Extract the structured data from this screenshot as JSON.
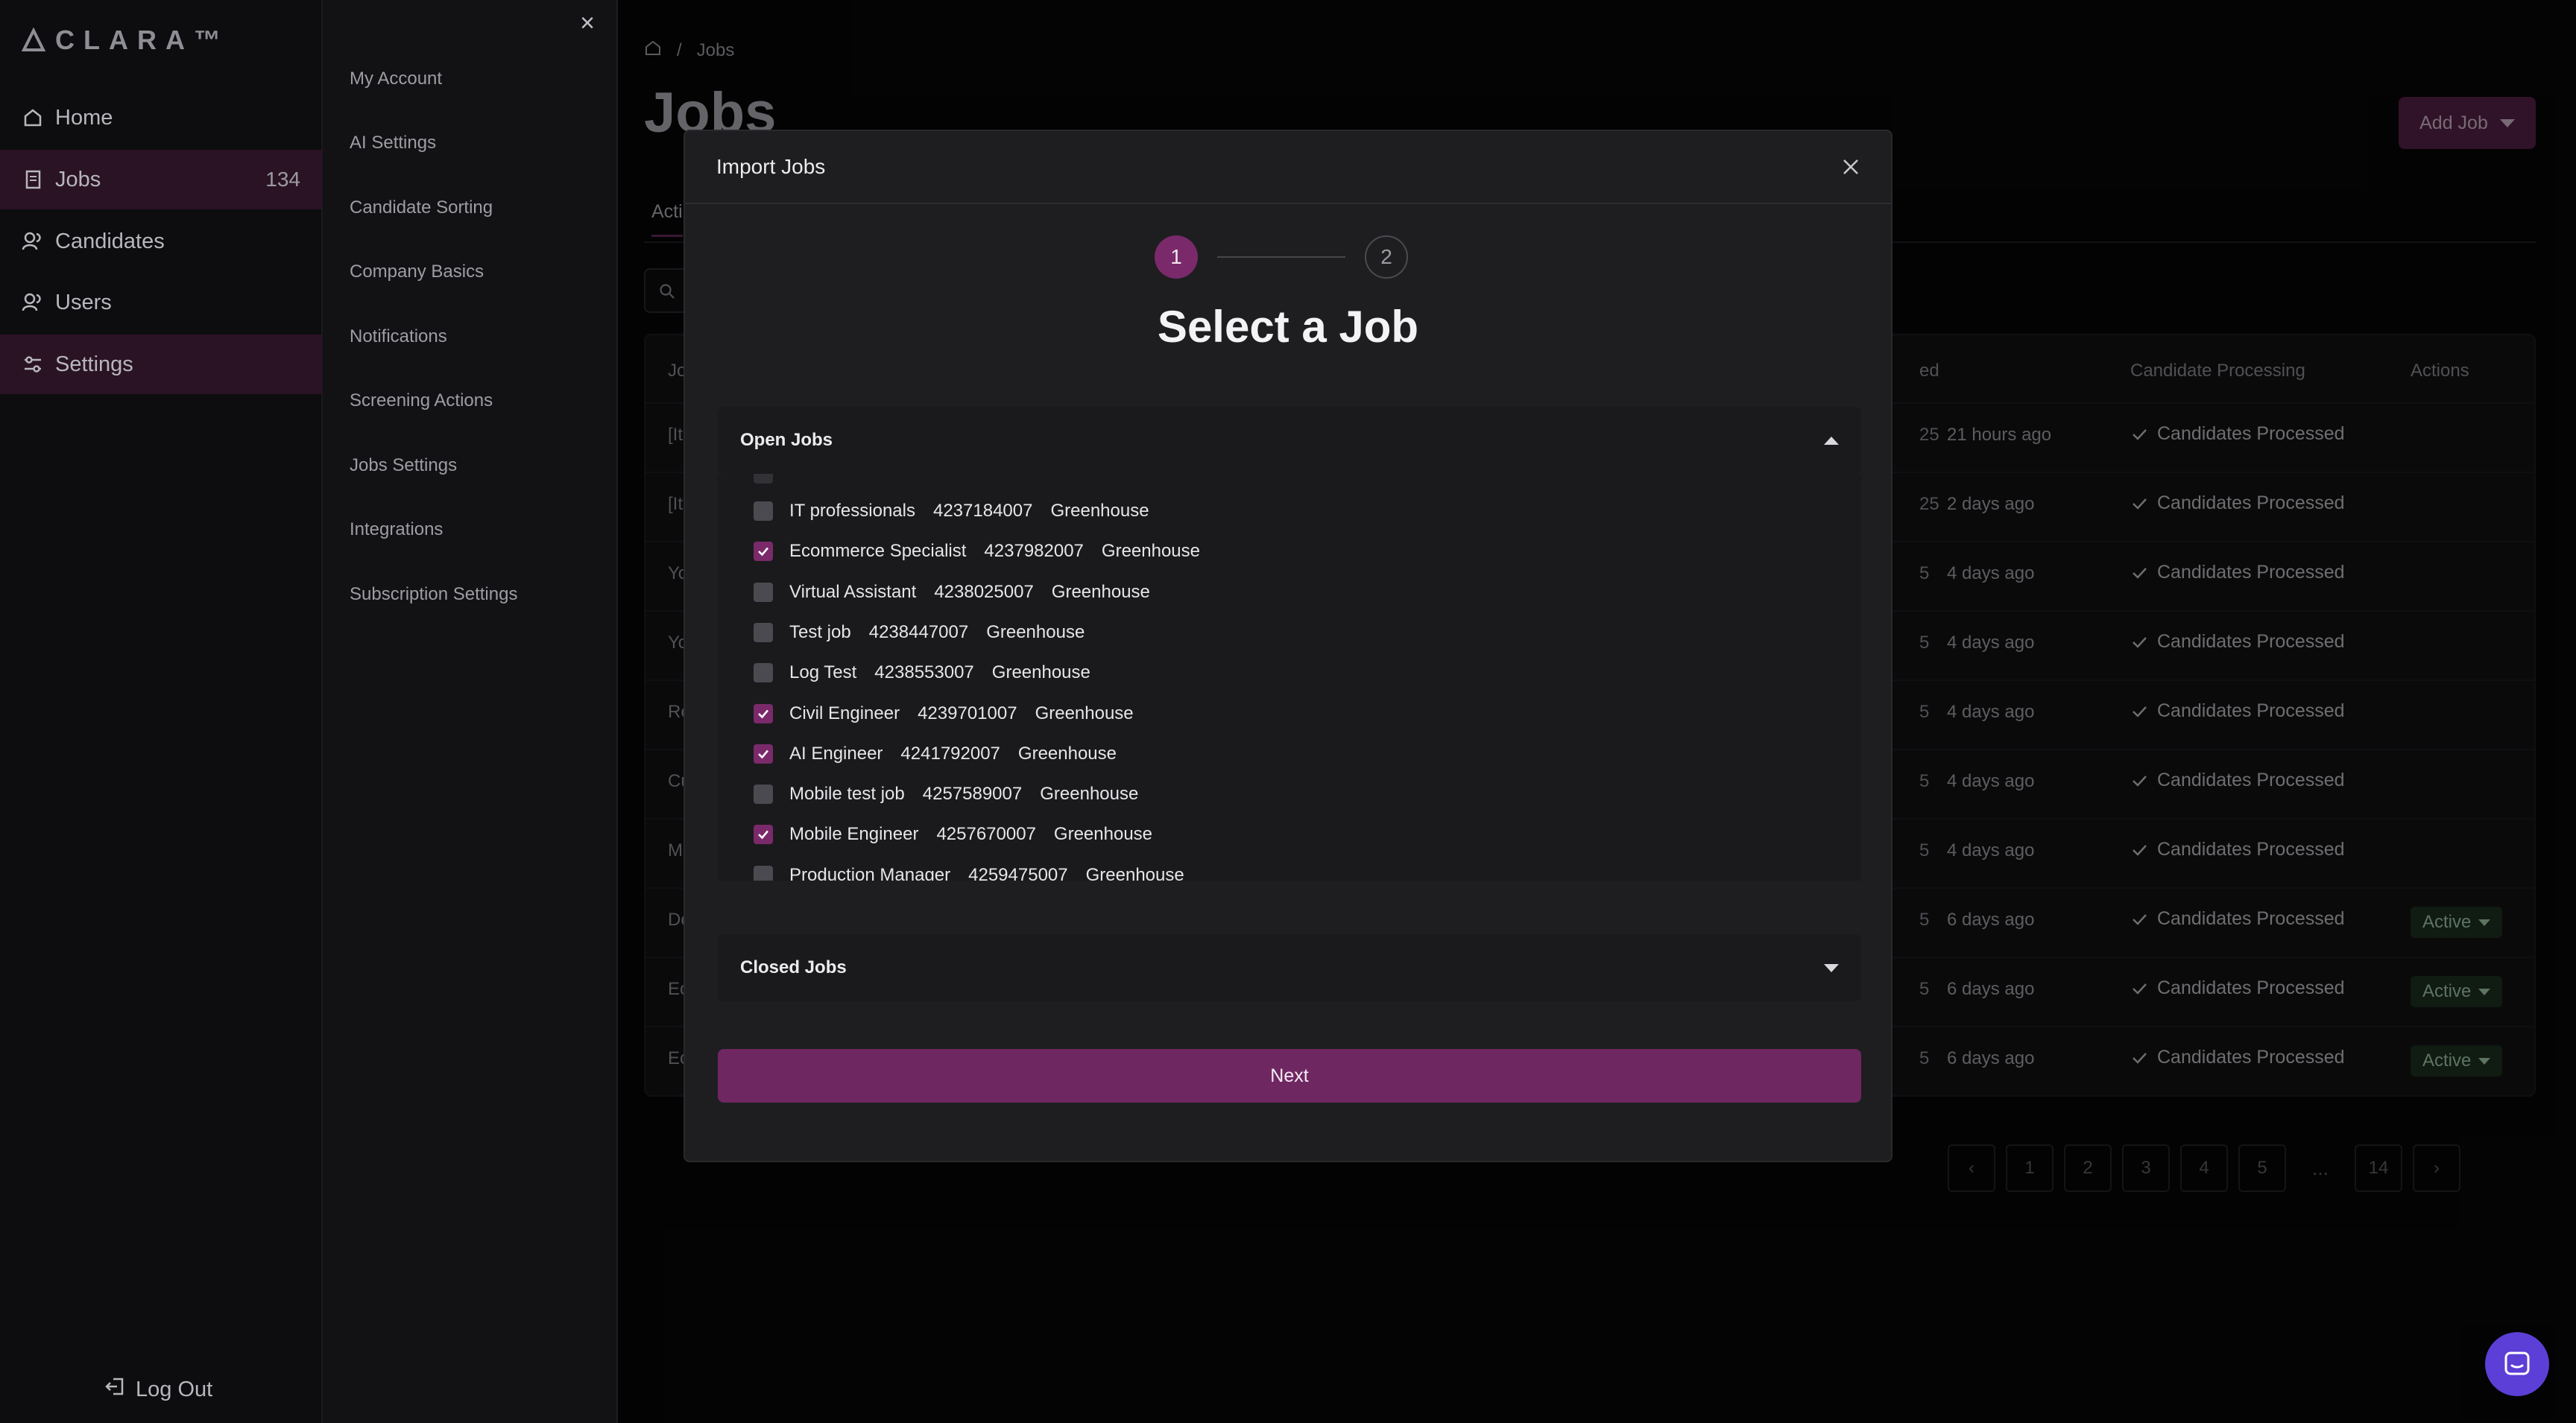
{
  "app": {
    "logo_text": "CLARA™"
  },
  "nav": {
    "items": [
      {
        "label": "Home",
        "count": ""
      },
      {
        "label": "Jobs",
        "count": "134"
      },
      {
        "label": "Candidates",
        "count": ""
      },
      {
        "label": "Users",
        "count": ""
      },
      {
        "label": "Settings",
        "count": ""
      }
    ],
    "logout": "Log Out"
  },
  "submenu": {
    "items": [
      "My Account",
      "AI Settings",
      "Candidate Sorting",
      "Company Basics",
      "Notifications",
      "Screening Actions",
      "Jobs Settings",
      "Integrations",
      "Subscription Settings"
    ]
  },
  "page": {
    "breadcrumb": [
      "Jobs"
    ],
    "title": "Jobs",
    "add_job": "Add Job",
    "tab_partial": "Acti",
    "columns": {
      "date_partial": "ed",
      "processing": "Candidate Processing",
      "actions": "Actions",
      "first_partial": "Jo"
    },
    "rows": [
      {
        "c0": "[It",
        "c1": "25",
        "c2": "21 hours ago",
        "c3": "Candidates Processed",
        "badge": ""
      },
      {
        "c0": "[It",
        "c1": "25",
        "c2": "2 days ago",
        "c3": "Candidates Processed",
        "badge": ""
      },
      {
        "c0": "Yo",
        "c1": "5",
        "c2": "4 days ago",
        "c3": "Candidates Processed",
        "badge": ""
      },
      {
        "c0": "Yo",
        "c1": "5",
        "c2": "4 days ago",
        "c3": "Candidates Processed",
        "badge": ""
      },
      {
        "c0": "Re",
        "c1": "5",
        "c2": "4 days ago",
        "c3": "Candidates Processed",
        "badge": ""
      },
      {
        "c0": "Cu",
        "c1": "5",
        "c2": "4 days ago",
        "c3": "Candidates Processed",
        "badge": ""
      },
      {
        "c0": "Ma",
        "c1": "5",
        "c2": "4 days ago",
        "c3": "Candidates Processed",
        "badge": ""
      },
      {
        "c0": "De",
        "c1": "5",
        "c2": "6 days ago",
        "c3": "Candidates Processed",
        "badge": "Active"
      },
      {
        "c0": "Ec",
        "c1": "5",
        "c2": "6 days ago",
        "c3": "Candidates Processed",
        "badge": "Active"
      },
      {
        "c0": "Ec",
        "c1": "5",
        "c2": "6 days ago",
        "c3": "Candidates Processed",
        "badge": "Active"
      }
    ],
    "pagination": [
      "1",
      "2",
      "3",
      "4",
      "5",
      "...",
      "14"
    ]
  },
  "modal": {
    "title": "Import Jobs",
    "steps": [
      "1",
      "2"
    ],
    "heading": "Select a Job",
    "open_section": "Open Jobs",
    "closed_section": "Closed Jobs",
    "jobs": [
      {
        "name": "IT professionals",
        "id": "4237184007",
        "source": "Greenhouse",
        "checked": false
      },
      {
        "name": "Ecommerce Specialist",
        "id": "4237982007",
        "source": "Greenhouse",
        "checked": true
      },
      {
        "name": "Virtual Assistant",
        "id": "4238025007",
        "source": "Greenhouse",
        "checked": false
      },
      {
        "name": "Test job",
        "id": "4238447007",
        "source": "Greenhouse",
        "checked": false
      },
      {
        "name": "Log Test",
        "id": "4238553007",
        "source": "Greenhouse",
        "checked": false
      },
      {
        "name": "Civil Engineer",
        "id": "4239701007",
        "source": "Greenhouse",
        "checked": true
      },
      {
        "name": "AI Engineer",
        "id": "4241792007",
        "source": "Greenhouse",
        "checked": true
      },
      {
        "name": "Mobile test job",
        "id": "4257589007",
        "source": "Greenhouse",
        "checked": false
      },
      {
        "name": "Mobile Engineer",
        "id": "4257670007",
        "source": "Greenhouse",
        "checked": true
      },
      {
        "name": "Production Manager",
        "id": "4259475007",
        "source": "Greenhouse",
        "checked": false
      }
    ],
    "next": "Next"
  },
  "colors": {
    "accent": "#7a2a6a",
    "button": "#6f2762",
    "active_badge": "#1a2a1d",
    "chat": "#5b3fd6"
  }
}
